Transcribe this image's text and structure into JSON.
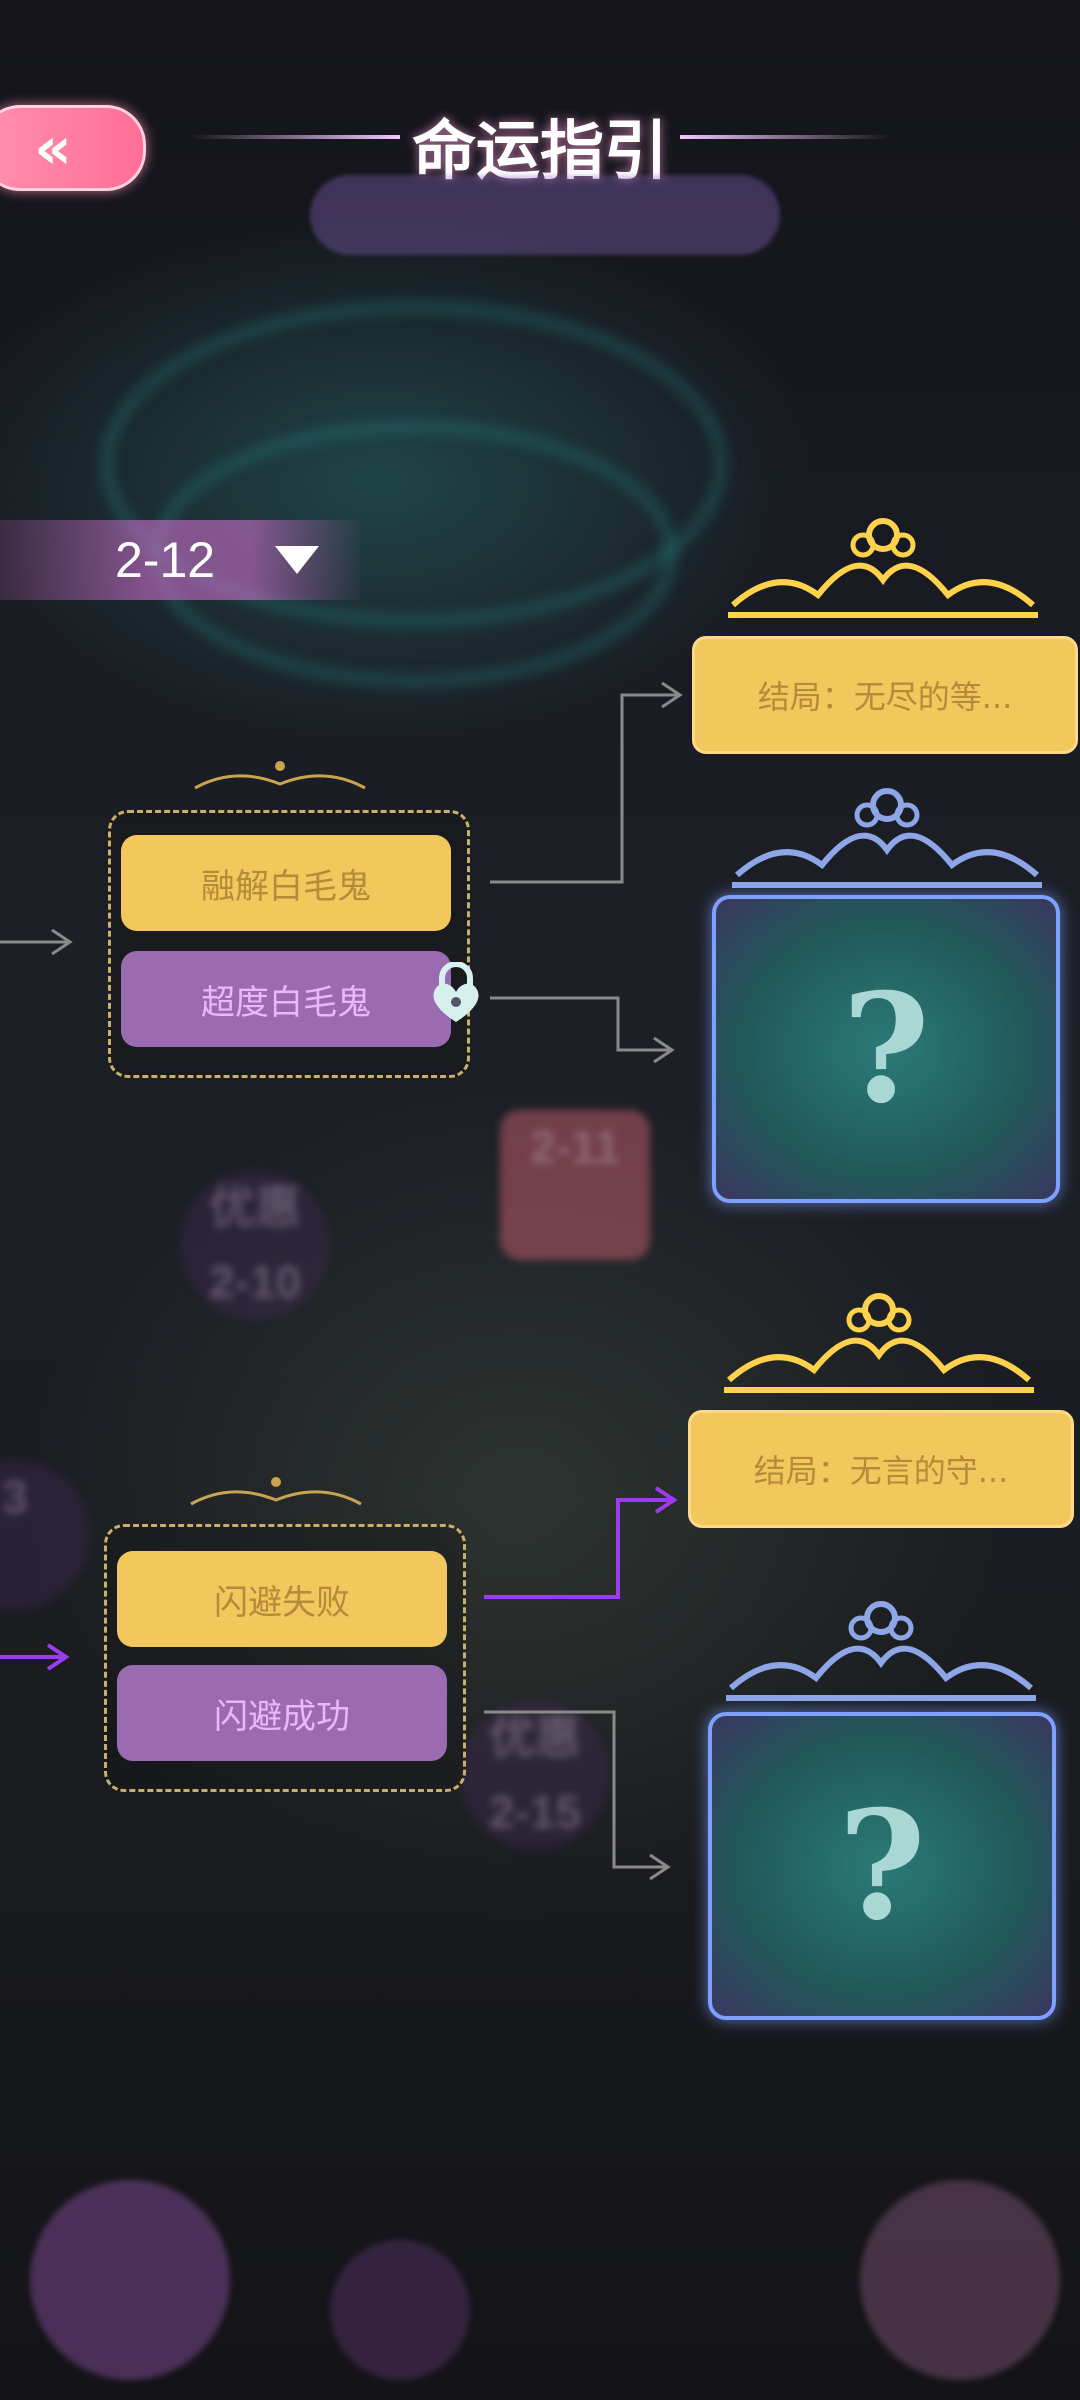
{
  "header": {
    "title": "命运指引",
    "back_icon": "double-chevron-left-icon"
  },
  "chapter_selector": {
    "value": "2-12"
  },
  "branch_top": {
    "choices": [
      {
        "label": "融解白毛鬼",
        "style": "gold"
      },
      {
        "label": "超度白毛鬼",
        "style": "purple",
        "locked": true
      }
    ],
    "endings": [
      {
        "label": "结局：无尽的等...",
        "revealed": true
      },
      {
        "label": "?",
        "revealed": false
      }
    ]
  },
  "branch_bottom": {
    "choices": [
      {
        "label": "闪避失败",
        "style": "gold"
      },
      {
        "label": "闪避成功",
        "style": "purple"
      }
    ],
    "endings": [
      {
        "label": "结局：无言的守...",
        "revealed": true
      },
      {
        "label": "?",
        "revealed": false
      }
    ]
  },
  "colors": {
    "gold": "#f2c85d",
    "purple": "#9a6bb0",
    "pink": "#ff7aa0",
    "highlight_path": "#9b3cf0",
    "path": "#8a8a8a"
  }
}
